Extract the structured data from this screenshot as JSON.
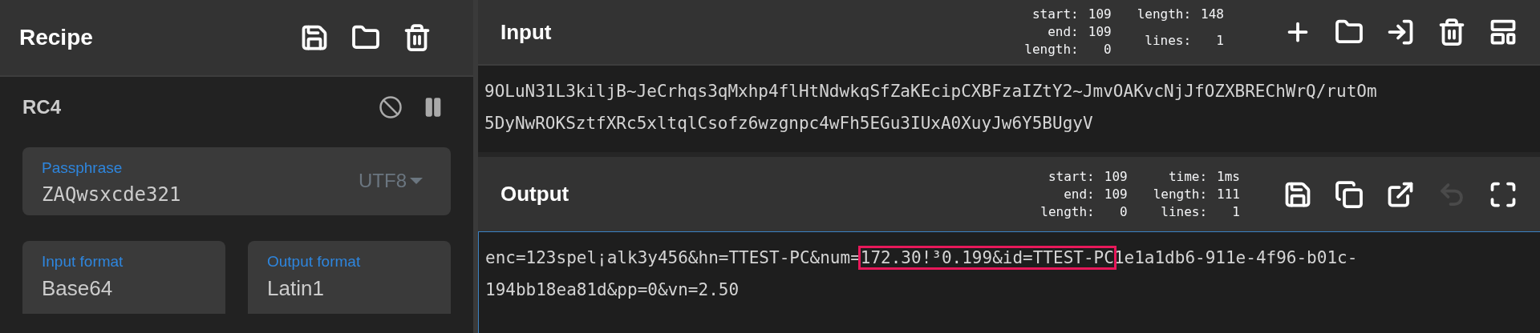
{
  "recipe": {
    "title": "Recipe",
    "operation": {
      "name": "RC4",
      "disabled": false,
      "paused": false,
      "passphrase": {
        "label": "Passphrase",
        "value": "ZAQwsxcde321",
        "encoding": "UTF8"
      },
      "formats": [
        {
          "label": "Input format",
          "value": "Base64"
        },
        {
          "label": "Output format",
          "value": "Latin1"
        }
      ]
    }
  },
  "input": {
    "title": "Input",
    "stats": [
      [
        {
          "label": "start:",
          "value": "109"
        },
        {
          "label": "end:",
          "value": "109"
        },
        {
          "label": "length:",
          "value": "0"
        }
      ],
      [
        {
          "label": "length:",
          "value": "148"
        },
        {
          "label": "lines:",
          "value": "1"
        }
      ]
    ],
    "lines": [
      "9OLuN31L3kiljB~JeCrhqs3qMxhp4flHtNdwkqSfZaKEcipCXBFzaIZtY2~JmvOAKvcNjJfOZXBREChWrQ/rutOm",
      "5DyNwROKSztfXRc5xltqlCsofz6wzgnpc4wFh5EGu3IUxA0XuyJw6Y5BUgyV"
    ]
  },
  "output": {
    "title": "Output",
    "stats": [
      [
        {
          "label": "start:",
          "value": "109"
        },
        {
          "label": "end:",
          "value": "109"
        },
        {
          "label": "length:",
          "value": "0"
        }
      ],
      [
        {
          "label": "time:",
          "value": "1ms"
        },
        {
          "label": "length:",
          "value": "111"
        },
        {
          "label": "lines:",
          "value": "1"
        }
      ]
    ],
    "undo_disabled": true,
    "segments": [
      {
        "text": "enc=123spel¡alk3y456&hn=TTEST-PC&num=",
        "highlighted": false
      },
      {
        "text": "172.30!³0.199&id=TTEST-PC",
        "highlighted": true
      },
      {
        "text": "1e1a1db6-911e-4f96-b01c-194bb18ea81d&pp=0&vn=2.50",
        "highlighted": false
      }
    ]
  }
}
